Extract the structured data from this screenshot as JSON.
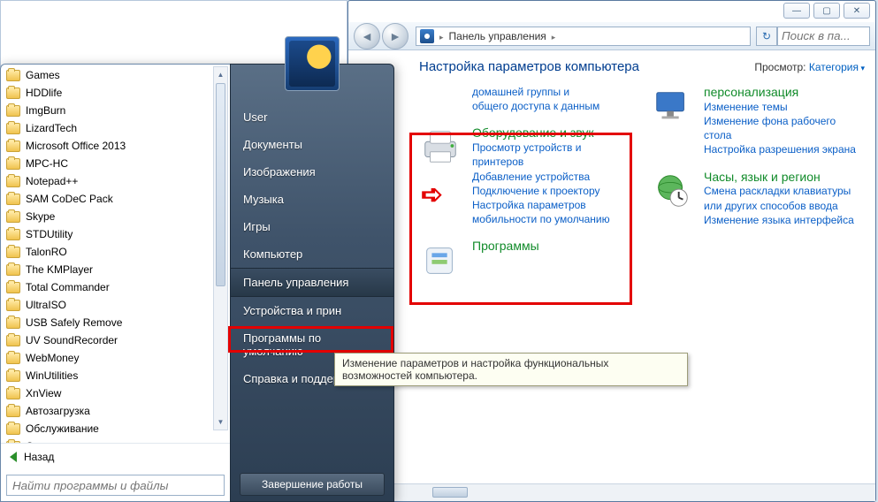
{
  "cp": {
    "breadcrumb": "Панель управления",
    "search_placeholder": "Поиск в па...",
    "title": "Настройка параметров компьютера",
    "view_label": "Просмотр:",
    "view_value": "Категория",
    "min_tip": "—",
    "max_tip": "▢",
    "close_tip": "✕"
  },
  "cats": {
    "homegroup": {
      "line1": "домашней группы и",
      "line2": "общего доступа к данным"
    },
    "hardware": {
      "title": "Оборудование и звук",
      "l1": "Просмотр устройств и принтеров",
      "l2": "Добавление устройства",
      "l3": "Подключение к проектору",
      "l4": "Настройка параметров мобильности по умолчанию"
    },
    "programs": {
      "title": "Программы"
    },
    "personalization": {
      "title": "персонализация",
      "l1": "Изменение темы",
      "l2": "Изменение фона рабочего стола",
      "l3": "Настройка разрешения экрана"
    },
    "clock": {
      "title": "Часы, язык и регион",
      "l1": "Смена раскладки клавиатуры или других способов ввода",
      "l2": "Изменение языка интерфейса"
    }
  },
  "start": {
    "folders": [
      "Games",
      "HDDlife",
      "ImgBurn",
      "LizardTech",
      "Microsoft Office 2013",
      "MPC-HC",
      "Notepad++",
      "SAM CoDeC Pack",
      "Skype",
      "STDUtility",
      "TalonRO",
      "The KMPlayer",
      "Total Commander",
      "UltraISO",
      "USB Safely Remove",
      "UV SoundRecorder",
      "WebMoney",
      "WinUtilities",
      "XnView",
      "Автозагрузка",
      "Обслуживание",
      "Стандартные"
    ],
    "back": "Назад",
    "search_placeholder": "Найти программы и файлы",
    "right": {
      "user": "User",
      "documents": "Документы",
      "images": "Изображения",
      "music": "Музыка",
      "games": "Игры",
      "computer": "Компьютер",
      "control_panel": "Панель управления",
      "devices": "Устройства и прин",
      "defaults": "Программы по умолчанию",
      "help": "Справка и поддержка",
      "shutdown": "Завершение работы"
    }
  },
  "tooltip": "Изменение параметров и настройка функциональных возможностей компьютера."
}
